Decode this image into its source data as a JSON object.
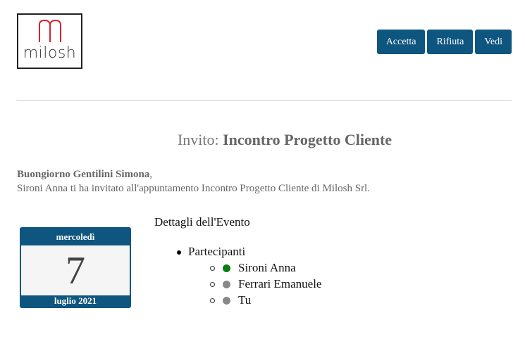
{
  "logo": {
    "text": "milosh"
  },
  "actions": {
    "accept": "Accetta",
    "decline": "Rifiuta",
    "view": "Vedi"
  },
  "invite": {
    "prefix": "Invito:",
    "subject": "Incontro Progetto Cliente"
  },
  "greeting": {
    "salutation": "Buongiorno Gentilini Simona",
    "punct": ",",
    "message": "Sironi Anna ti ha invitato all'appuntamento Incontro Progetto Cliente di Milosh Srl."
  },
  "calendar": {
    "weekday": "mercoledì",
    "day": "7",
    "month_year": "luglio 2021"
  },
  "details": {
    "title": "Dettagli dell'Evento",
    "participants_label": "Partecipanti",
    "participants": [
      {
        "name": "Sironi Anna",
        "status_color": "#0a7d10"
      },
      {
        "name": "Ferrari Emanuele",
        "status_color": "#888888"
      },
      {
        "name": "Tu",
        "status_color": "#888888"
      }
    ]
  },
  "colors": {
    "accent": "#0e5580",
    "logo_m": "#d9232d"
  }
}
